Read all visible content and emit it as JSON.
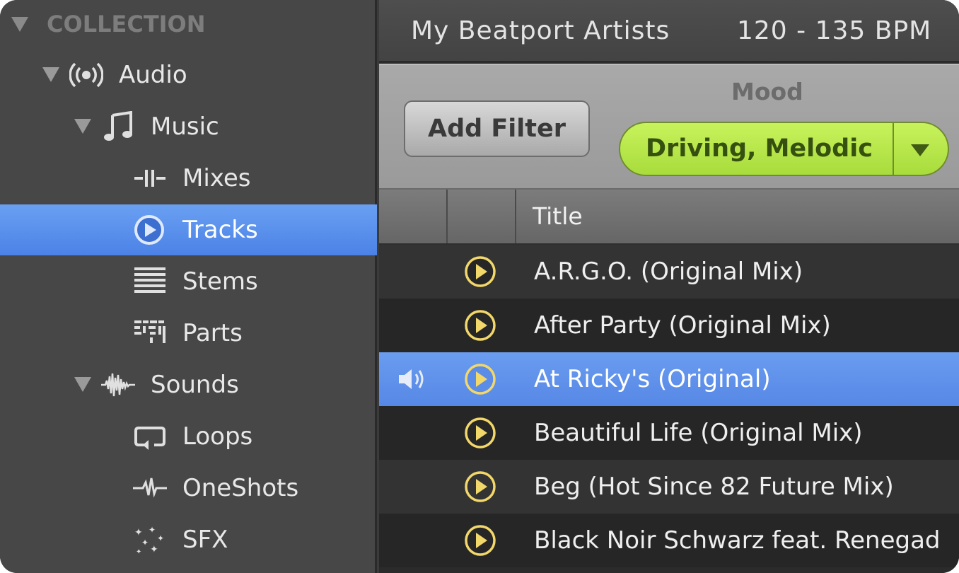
{
  "sidebar": {
    "header": "COLLECTION",
    "items": [
      {
        "label": "Audio",
        "icon": "broadcast-icon",
        "expanded": true
      },
      {
        "label": "Music",
        "icon": "music-note-icon",
        "expanded": true
      },
      {
        "label": "Mixes",
        "icon": "mixes-icon"
      },
      {
        "label": "Tracks",
        "icon": "play-circle-icon",
        "selected": true
      },
      {
        "label": "Stems",
        "icon": "stems-icon"
      },
      {
        "label": "Parts",
        "icon": "parts-icon"
      },
      {
        "label": "Sounds",
        "icon": "waveform-icon",
        "expanded": true
      },
      {
        "label": "Loops",
        "icon": "loop-icon"
      },
      {
        "label": "OneShots",
        "icon": "oneshot-icon"
      },
      {
        "label": "SFX",
        "icon": "sparkle-icon"
      }
    ]
  },
  "main": {
    "collection_name": "My Beatport Artists",
    "bpm_range": "120 - 135 BPM",
    "filter": {
      "add_label": "Add Filter",
      "mood_label": "Mood",
      "mood_value": "Driving, Melodic"
    },
    "table": {
      "title_header": "Title",
      "rows": [
        {
          "title": "A.R.G.O. (Original Mix)"
        },
        {
          "title": "After Party (Original Mix)"
        },
        {
          "title": "At Ricky's (Original)",
          "playing": true
        },
        {
          "title": "Beautiful Life (Original Mix)"
        },
        {
          "title": "Beg (Hot Since 82 Future Mix)"
        },
        {
          "title": "Black Noir Schwarz feat. Renegad"
        }
      ]
    }
  },
  "colors": {
    "selection_blue": "#5688e6",
    "mood_green": "#b6e64a",
    "play_yellow": "#f2d76a"
  }
}
